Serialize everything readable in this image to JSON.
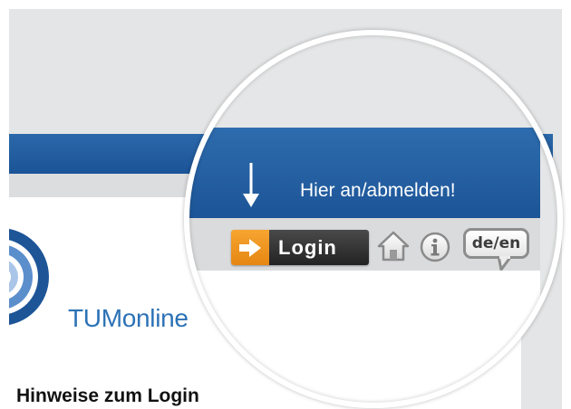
{
  "header": {
    "hint_text": "Hier an/abmelden!",
    "arrow_icon": "arrow-down-icon"
  },
  "toolbar": {
    "login_label": "Login",
    "login_icon": "arrow-right-icon",
    "home_icon": "home-icon",
    "info_icon": "info-icon",
    "lang_label": "de/en"
  },
  "brand": {
    "name": "TUMonline",
    "logo_icon": "tumonline-logo-arc"
  },
  "content": {
    "heading": "Hinweise zum Login"
  },
  "colors": {
    "banner_blue": "#2462a5",
    "login_orange": "#f29a24",
    "login_dark": "#333333",
    "brand_blue": "#2c72b6",
    "toolbar_grey": "#dadbdc"
  }
}
